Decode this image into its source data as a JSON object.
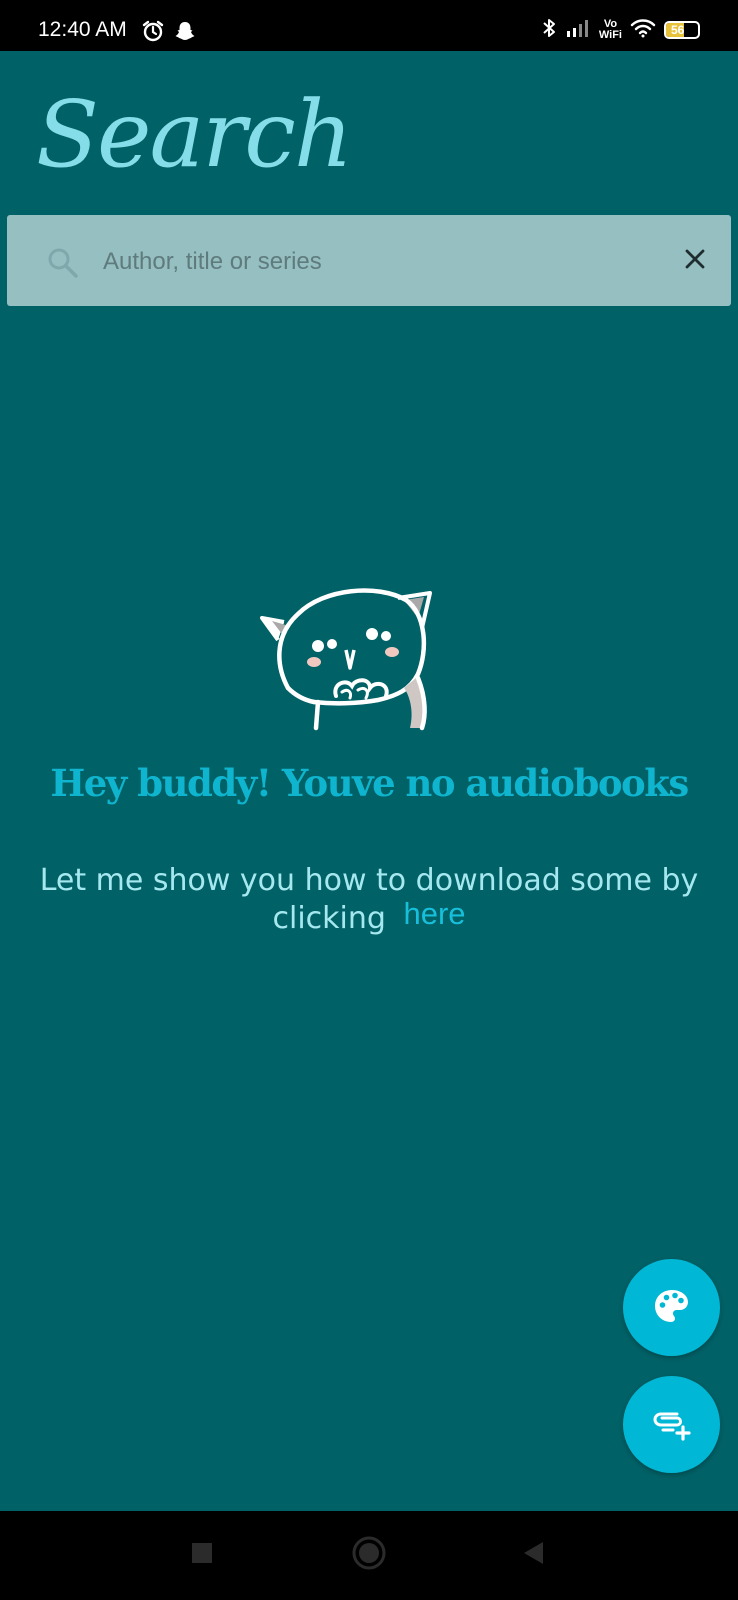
{
  "status_bar": {
    "time": "12:40 AM",
    "left_icons": [
      "alarm-icon",
      "snapchat-icon"
    ],
    "right_icons": [
      "bluetooth-icon",
      "signal-icon",
      "vowifi-icon",
      "wifi-icon",
      "battery-icon"
    ],
    "vowifi_line1": "Vo",
    "vowifi_line2": "WiFi",
    "battery_level": "56"
  },
  "header": {
    "title": "Search"
  },
  "search": {
    "placeholder": "Author, title or series",
    "value": "",
    "search_icon": "search-icon",
    "clear_icon": "close-icon"
  },
  "empty_state": {
    "illustration": "cat-illustration",
    "heading": "Hey buddy! Youve no audiobooks",
    "message": "Let me show you how to download some by clicking",
    "link_label": "here"
  },
  "fabs": {
    "theme_icon": "palette-icon",
    "add_icon": "add-audiobook-icon"
  },
  "nav_bar": {
    "icons": [
      "recents-icon",
      "home-icon",
      "back-icon"
    ]
  },
  "colors": {
    "background": "#006166",
    "title": "#84dde8",
    "search_bar": "#95bfc1",
    "heading": "#0fb4cf",
    "message": "#a6e8ef",
    "link": "#17bfdb",
    "fab": "#00b8d5"
  }
}
